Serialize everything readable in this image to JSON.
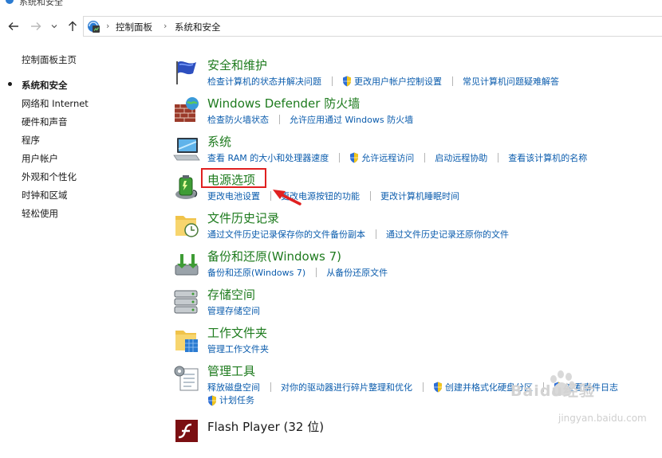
{
  "window": {
    "title": "系统和安全"
  },
  "address": {
    "crumbs": [
      "控制面板",
      "系统和安全"
    ]
  },
  "sidebar": {
    "items": [
      {
        "label": "控制面板主页"
      },
      {
        "label": "系统和安全",
        "active": true
      },
      {
        "label": "网络和 Internet"
      },
      {
        "label": "硬件和声音"
      },
      {
        "label": "程序"
      },
      {
        "label": "用户帐户"
      },
      {
        "label": "外观和个性化"
      },
      {
        "label": "时钟和区域"
      },
      {
        "label": "轻松使用"
      }
    ]
  },
  "categories": [
    {
      "title": "安全和维护",
      "links": [
        "检查计算机的状态并解决问题",
        "更改用户帐户控制设置",
        "常见计算机问题疑难解答"
      ]
    },
    {
      "title": "Windows Defender 防火墙",
      "links": [
        "检查防火墙状态",
        "允许应用通过 Windows 防火墙"
      ]
    },
    {
      "title": "系统",
      "links": [
        "查看 RAM 的大小和处理器速度",
        "允许远程访问",
        "启动远程协助",
        "查看该计算机的名称"
      ]
    },
    {
      "title": "电源选项",
      "links": [
        "更改电池设置",
        "更改电源按钮的功能",
        "更改计算机睡眠时间"
      ]
    },
    {
      "title": "文件历史记录",
      "links": [
        "通过文件历史记录保存你的文件备份副本",
        "通过文件历史记录还原你的文件"
      ]
    },
    {
      "title": "备份和还原(Windows 7)",
      "links": [
        "备份和还原(Windows 7)",
        "从备份还原文件"
      ]
    },
    {
      "title": "存储空间",
      "links": [
        "管理存储空间"
      ]
    },
    {
      "title": "工作文件夹",
      "links": [
        "管理工作文件夹"
      ]
    },
    {
      "title": "管理工具",
      "links": [
        "释放磁盘空间",
        "对你的驱动器进行碎片整理和优化",
        "创建并格式化硬盘分区",
        "查看事件日志",
        "计划任务"
      ]
    },
    {
      "title": "Flash Player (32 位)",
      "links": []
    }
  ],
  "watermark": {
    "text": "Baidu经验",
    "url": "jingyan.baidu.com"
  },
  "colors": {
    "category_title": "#1e7b1e",
    "link": "#0b5cad",
    "highlight": "#e02020"
  }
}
